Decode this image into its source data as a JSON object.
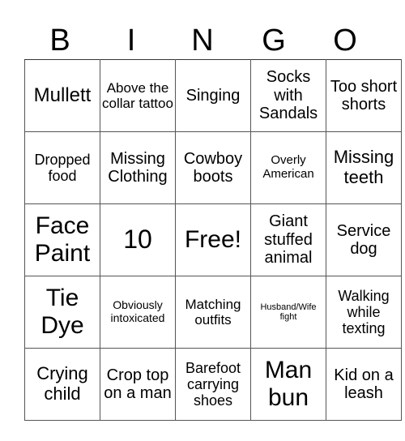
{
  "header": {
    "letters": [
      "B",
      "I",
      "N",
      "G",
      "O"
    ]
  },
  "grid": {
    "rows": [
      [
        "Mullett",
        "Above the collar tattoo",
        "Singing",
        "Socks with Sandals",
        "Too short shorts"
      ],
      [
        "Dropped food",
        "Missing Clothing",
        "Cowboy boots",
        "Overly American",
        "Missing teeth"
      ],
      [
        "Face Paint",
        "10",
        "Free!",
        "Giant stuffed animal",
        "Service dog"
      ],
      [
        "Tie Dye",
        "Obviously intoxicated",
        "Matching outfits",
        "Husband/Wife fight",
        "Walking while texting"
      ],
      [
        "Crying child",
        "Crop top on a man",
        "Barefoot carrying shoes",
        "Man bun",
        "Kid on a leash"
      ]
    ]
  }
}
